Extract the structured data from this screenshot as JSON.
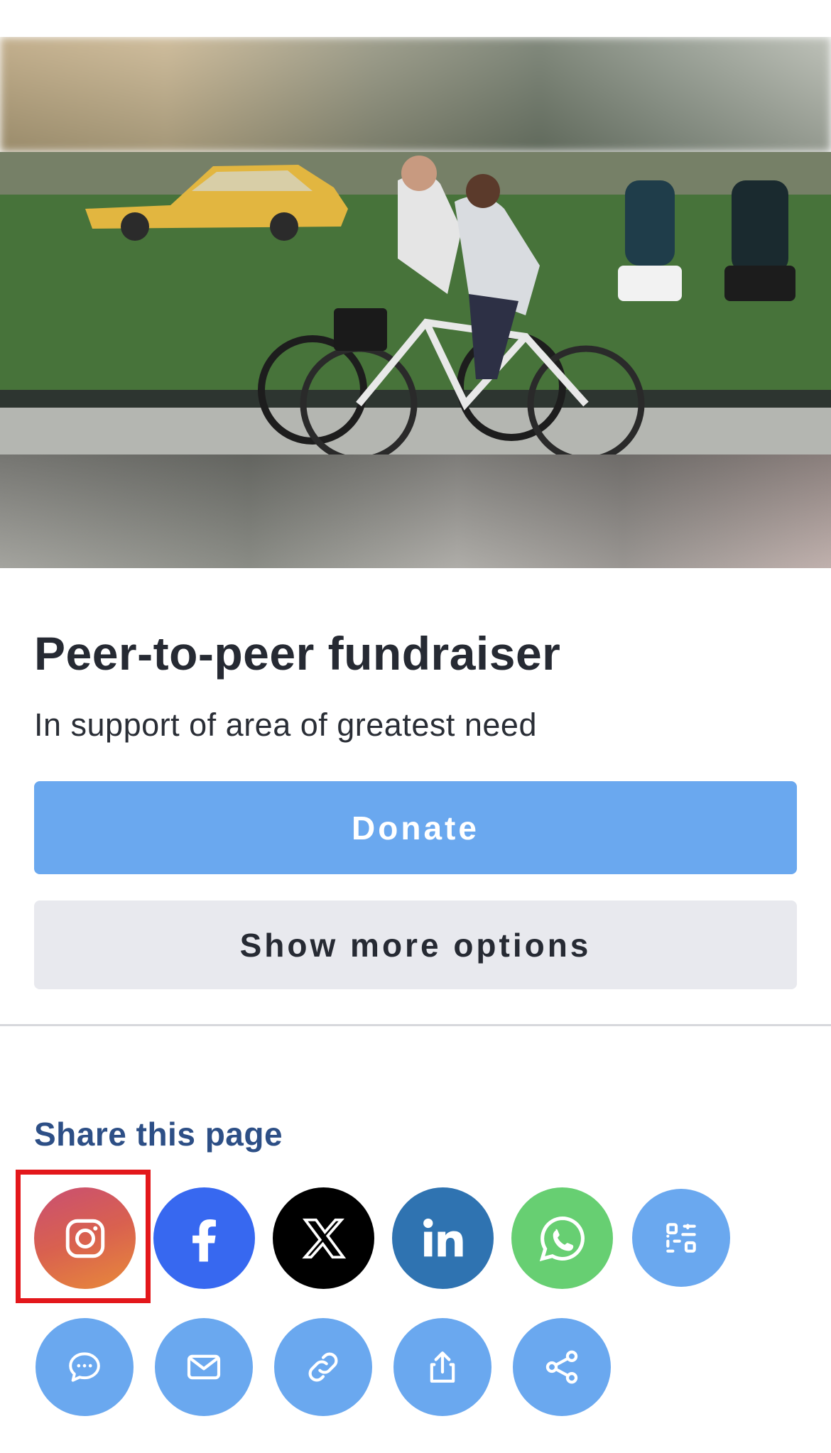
{
  "fundraiser": {
    "title": "Peer-to-peer fundraiser",
    "subtitle": "In support of area of greatest need"
  },
  "actions": {
    "donate_label": "Donate",
    "more_options_label": "Show more options"
  },
  "share": {
    "heading": "Share this page",
    "buttons": [
      {
        "icon": "instagram-icon",
        "color": "#d9614f"
      },
      {
        "icon": "facebook-icon",
        "color": "#3768f0"
      },
      {
        "icon": "x-icon",
        "color": "#000000"
      },
      {
        "icon": "linkedin-icon",
        "color": "#2f73b1"
      },
      {
        "icon": "whatsapp-icon",
        "color": "#67cf72"
      },
      {
        "icon": "qr-code-icon",
        "color": "#6aa8ef"
      },
      {
        "icon": "sms-icon",
        "color": "#6aa8ef"
      },
      {
        "icon": "email-icon",
        "color": "#6aa8ef"
      },
      {
        "icon": "link-icon",
        "color": "#6aa8ef"
      },
      {
        "icon": "upload-share-icon",
        "color": "#6aa8ef"
      },
      {
        "icon": "share-nodes-icon",
        "color": "#6aa8ef"
      }
    ]
  },
  "colors": {
    "primary": "#6aa8ef",
    "secondary_button": "#e8e9ee",
    "heading_blue": "#2d4f86",
    "highlight": "#e3171b"
  }
}
